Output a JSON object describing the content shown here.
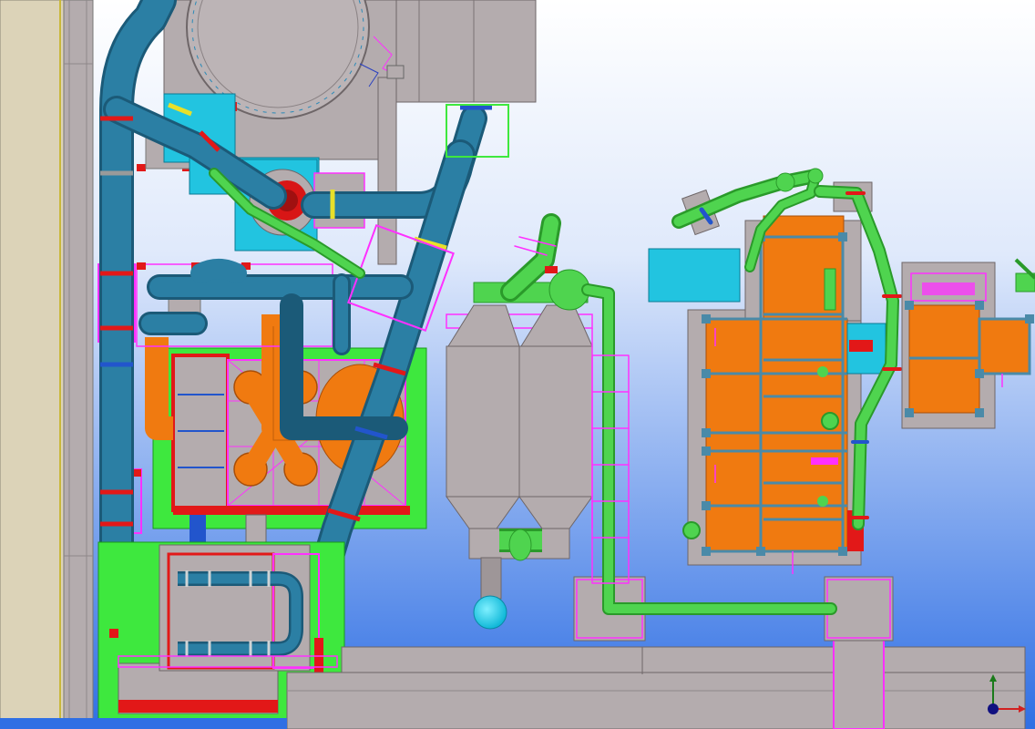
{
  "viewport": {
    "background_top": "#ffffff",
    "background_bottom": "#2f6fe4"
  },
  "axis_triad": {
    "icon": "xyz-axis-triad-icon",
    "colors": {
      "x": "#d22020",
      "y": "#1a7a1a",
      "z": "#101080"
    }
  },
  "palette": {
    "steel_grey": "#b4acae",
    "process_pipe": "#2b7fa4",
    "process_pipe_edge": "#1b5a78",
    "utility_pipe": "#4fd44f",
    "utility_pipe_edge": "#2a9a2a",
    "tank_orange": "#f07a10",
    "frame_magenta": "#ff30ff",
    "structure_red": "#e21818",
    "structure_green": "#3ee83e",
    "equipment_cyan": "#22c4e0",
    "wall_tan": "#dcd3b8",
    "frame_steel_blue": "#4a8aa8"
  },
  "zones": [
    "wall-left",
    "reactor-vessel",
    "process-pipe-loop",
    "pump-skid-red-frame",
    "lower-heat-exchanger-skid",
    "twin-cyclone-separator",
    "utility-pipe-run",
    "orange-tank-module",
    "auxiliary-module",
    "floor-beams"
  ]
}
